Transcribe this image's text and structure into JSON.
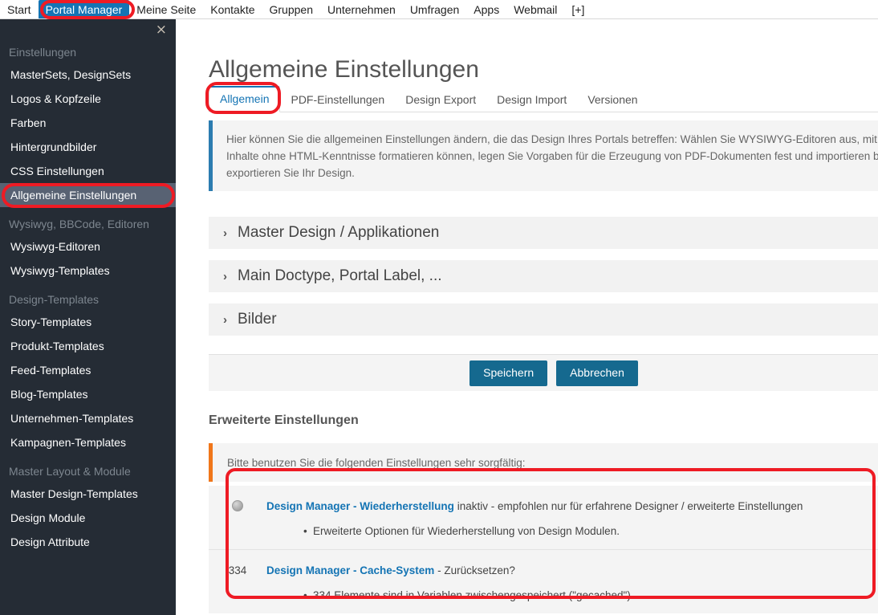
{
  "topnav": {
    "items": [
      {
        "label": "Start",
        "active": false
      },
      {
        "label": "Portal Manager",
        "active": true
      },
      {
        "label": "Meine Seite",
        "active": false
      },
      {
        "label": "Kontakte",
        "active": false
      },
      {
        "label": "Gruppen",
        "active": false
      },
      {
        "label": "Unternehmen",
        "active": false
      },
      {
        "label": "Umfragen",
        "active": false
      },
      {
        "label": "Apps",
        "active": false
      },
      {
        "label": "Webmail",
        "active": false
      },
      {
        "label": "[+]",
        "active": false
      }
    ]
  },
  "sidebar": {
    "close_icon": "×",
    "groups": [
      {
        "title": "Einstellungen",
        "items": [
          {
            "label": "MasterSets, DesignSets",
            "active": false
          },
          {
            "label": "Logos & Kopfzeile",
            "active": false
          },
          {
            "label": "Farben",
            "active": false
          },
          {
            "label": "Hintergrundbilder",
            "active": false
          },
          {
            "label": "CSS Einstellungen",
            "active": false
          },
          {
            "label": "Allgemeine Einstellungen",
            "active": true
          }
        ]
      },
      {
        "title": "Wysiwyg, BBCode, Editoren",
        "items": [
          {
            "label": "Wysiwyg-Editoren",
            "active": false
          },
          {
            "label": "Wysiwyg-Templates",
            "active": false
          }
        ]
      },
      {
        "title": "Design-Templates",
        "items": [
          {
            "label": "Story-Templates",
            "active": false
          },
          {
            "label": "Produkt-Templates",
            "active": false
          },
          {
            "label": "Feed-Templates",
            "active": false
          },
          {
            "label": "Blog-Templates",
            "active": false
          },
          {
            "label": "Unternehmen-Templates",
            "active": false
          },
          {
            "label": "Kampagnen-Templates",
            "active": false
          }
        ]
      },
      {
        "title": "Master Layout & Module",
        "items": [
          {
            "label": "Master Design-Templates",
            "active": false
          },
          {
            "label": "Design Module",
            "active": false
          },
          {
            "label": "Design Attribute",
            "active": false
          }
        ]
      }
    ]
  },
  "main": {
    "page_title": "Allgemeine Einstellungen",
    "tabs": [
      {
        "label": "Allgemein",
        "active": true
      },
      {
        "label": "PDF-Einstellungen",
        "active": false
      },
      {
        "label": "Design Export",
        "active": false
      },
      {
        "label": "Design Import",
        "active": false
      },
      {
        "label": "Versionen",
        "active": false
      }
    ],
    "info_text_lines": [
      "Hier können Sie die allgemeinen Einstellungen ändern, die das Design Ihres Portals betreffen: Wählen Sie WYSIWYG-Editoren aus, mit denen Sie",
      "Inhalte ohne HTML-Kenntnisse formatieren können, legen Sie Vorgaben für die Erzeugung von PDF-Dokumenten fest und importieren bzw.",
      "exportieren Sie Ihr Design."
    ],
    "accordions": [
      {
        "label": "Master Design / Applikationen",
        "chevron": "›"
      },
      {
        "label": "Main Doctype, Portal Label, ...",
        "chevron": "›"
      },
      {
        "label": "Bilder",
        "chevron": "›"
      }
    ],
    "buttons": {
      "save_label": "Speichern",
      "cancel_label": "Abbrechen"
    },
    "advanced": {
      "title": "Erweiterte Einstellungen",
      "warning_text": "Bitte benutzen Sie die folgenden Einstellungen sehr sorgfältig:",
      "options": [
        {
          "marker_type": "radio",
          "marker_value": "",
          "link_text": "Design Manager - Wiederherstellung",
          "rest_text": " inaktiv - empfohlen nur für erfahrene Designer / erweiterte Einstellungen",
          "bullets": [
            "Erweiterte Optionen für Wiederherstellung von Design Modulen."
          ]
        },
        {
          "marker_type": "count",
          "marker_value": "334",
          "link_text": "Design Manager - Cache-System",
          "rest_text": " - Zurücksetzen?",
          "bullets": [
            "334 Elemente sind in Variablen zwischengespeichert (\"gecached\")."
          ]
        }
      ]
    }
  },
  "colors": {
    "accent_blue": "#1474b4",
    "button_blue": "#15698f",
    "sidebar_bg": "#252c35",
    "sidebar_active": "#586273",
    "info_border": "#2c7cb0",
    "warn_border": "#f0761a",
    "annotation_red": "#ee1b24"
  }
}
